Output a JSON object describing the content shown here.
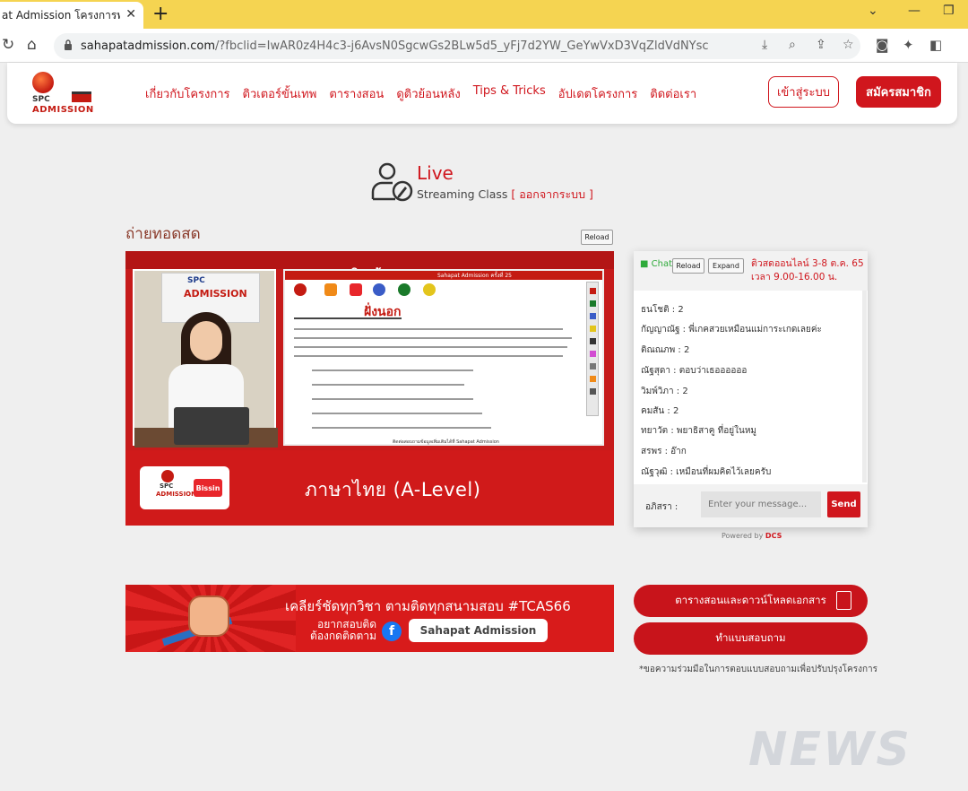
{
  "browser": {
    "tab_title": "at Admission โครงการพบทางฯ",
    "tab_close": "✕",
    "new_tab": "+",
    "url_host": "sahapatadmission.com",
    "url_rest": "/?fbclid=IwAR0z4H4c3-j6AvsN0SgcwGs2BLw5d5_yFj7d2YW_GeYwVxD3VqZldVdNYsc",
    "accent": "#f5d451"
  },
  "header": {
    "logo_spc": "SPC",
    "logo_admission": "ADMISSION",
    "nav": [
      "เกี่ยวกับโครงการ",
      "ติวเตอร์ขั้นเทพ",
      "ตารางสอน",
      "ดูติวย้อนหลัง",
      "Tips & Tricks",
      "อัปเดตโครงการ",
      "ติดต่อเรา"
    ],
    "login": "เข้าสู่ระบบ",
    "register": "สมัครสมาชิก",
    "brand_color": "#d0161d"
  },
  "live": {
    "title": "Live",
    "subtitle": "Streaming Class",
    "logout": "[ ออกจากระบบ ]"
  },
  "section_title": "ถ่ายทอดสด",
  "video": {
    "reload": "Reload",
    "headline": "ภาษา เสริมสร้างสุข",
    "board_spc": "SPC",
    "board_admission": "ADMISSION",
    "doc_header": "Sahapat Admission ครั้งที่ 25",
    "handwriting": "ฝั่งนอก",
    "doc_footer": "ติดต่อสอบถามข้อมูลเพิ่มเติมได้ที่  Sahapat Admission",
    "bottom_spc": "SPC",
    "bottom_admission": "ADMISSION",
    "bissin": "Bissin",
    "subject": "ภาษาไทย (A-Level)"
  },
  "chat": {
    "label": "Chat",
    "reload": "Reload",
    "expand": "Expand",
    "event": "ติวสดออนไลน์ 3-8 ต.ค. 65 เวลา 9.00-16.00 น.",
    "messages": [
      "ธนโชติ : 2",
      "กัญญาณัฐ : พี่เกคสวยเหมือนแม่การะเกดเลยค่ะ",
      "ติณณภพ : 2",
      "ณัฐสุดา : ตอบว่าเธออออออ",
      "วิมพ์วิภา : 2",
      "คมสัน : 2",
      "ทยาวัต : พยาธิสาคู ที่อยู่ในหมู",
      "สรพร : อ๊าก",
      "ณัฐวุฒิ : เหมือนที่ผมคิดไว้เลยครับ"
    ],
    "user": "อภิสรา :",
    "input_placeholder": "Enter your message...",
    "send": "Send",
    "powered_prefix": "Powered by",
    "powered_brand": "DCS"
  },
  "banner": {
    "line1": "เคลียร์ชัดทุกวิชา ตามติดทุกสนามสอบ #TCAS66",
    "line2": "อยากสอบติด ต้องกดติดตาม",
    "fb": "f",
    "pill": "Sahapat Admission"
  },
  "side": {
    "schedule_btn": "ตารางสอนและดาวน์โหลดเอกสาร",
    "survey_btn": "ทำแบบสอบถาม",
    "note": "*ขอความร่วมมือในการตอบแบบสอบถามเพื่อปรับปรุงโครงการ"
  },
  "watermark": "NEWS"
}
